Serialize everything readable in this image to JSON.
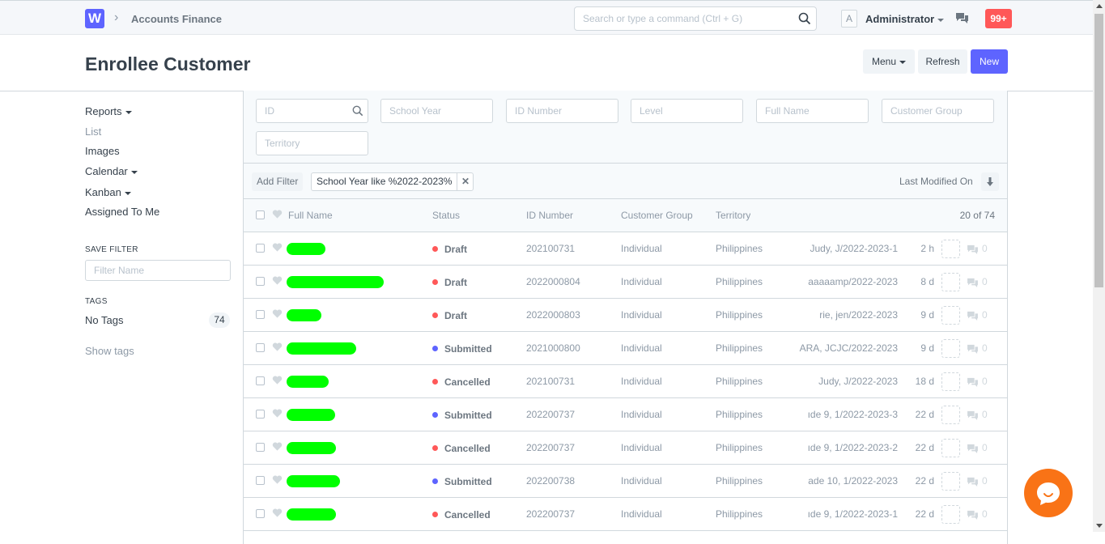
{
  "navbar": {
    "logo_letter": "W",
    "breadcrumb": "Accounts Finance",
    "search_placeholder": "Search or type a command (Ctrl + G)",
    "avatar_letter": "A",
    "user": "Administrator",
    "notifications": "99+"
  },
  "page": {
    "title": "Enrollee Customer",
    "menu_label": "Menu",
    "refresh_label": "Refresh",
    "new_label": "New"
  },
  "sidebar": {
    "items": [
      {
        "label": "Reports",
        "dropdown": true
      },
      {
        "label": "List",
        "dropdown": false
      },
      {
        "label": "Images",
        "dropdown": false
      },
      {
        "label": "Calendar",
        "dropdown": true
      },
      {
        "label": "Kanban",
        "dropdown": true
      },
      {
        "label": "Assigned To Me",
        "dropdown": false
      }
    ],
    "save_filter_label": "SAVE FILTER",
    "filter_name_placeholder": "Filter Name",
    "tags_label": "TAGS",
    "no_tags_label": "No Tags",
    "no_tags_count": "74",
    "show_tags_label": "Show tags"
  },
  "filters": {
    "fields": [
      "ID",
      "School Year",
      "ID Number",
      "Level",
      "Full Name",
      "Customer Group",
      "Territory"
    ],
    "add_filter_label": "Add Filter",
    "active_filter": "School Year like %2022-2023%",
    "sort_label": "Last Modified On"
  },
  "list": {
    "columns": {
      "full_name": "Full Name",
      "status": "Status",
      "id_number": "ID Number",
      "customer_group": "Customer Group",
      "territory": "Territory"
    },
    "count": "20 of 74",
    "rows": [
      {
        "status": "Draft",
        "status_color": "#ff5858",
        "id_number": "202100731",
        "customer_group": "Individual",
        "territory": "Philippines",
        "ref": "Judy, J/2022-2023-1",
        "modified": "2 h",
        "comments": "0"
      },
      {
        "status": "Draft",
        "status_color": "#ff5858",
        "id_number": "2022000804",
        "customer_group": "Individual",
        "territory": "Philippines",
        "ref": "aaaaamp/2022-2023",
        "modified": "8 d",
        "comments": "0"
      },
      {
        "status": "Draft",
        "status_color": "#ff5858",
        "id_number": "2022000803",
        "customer_group": "Individual",
        "territory": "Philippines",
        "ref": "rie, jen/2022-2023",
        "modified": "9 d",
        "comments": "0"
      },
      {
        "status": "Submitted",
        "status_color": "#5e64ff",
        "id_number": "2021000800",
        "customer_group": "Individual",
        "territory": "Philippines",
        "ref": "ARA, JCJC/2022-2023",
        "modified": "9 d",
        "comments": "0"
      },
      {
        "status": "Cancelled",
        "status_color": "#ff5858",
        "id_number": "202100731",
        "customer_group": "Individual",
        "territory": "Philippines",
        "ref": "Judy, J/2022-2023",
        "modified": "18 d",
        "comments": "0"
      },
      {
        "status": "Submitted",
        "status_color": "#5e64ff",
        "id_number": "202200737",
        "customer_group": "Individual",
        "territory": "Philippines",
        "ref": "ıde 9, 1/2022-2023-3",
        "modified": "22 d",
        "comments": "0"
      },
      {
        "status": "Cancelled",
        "status_color": "#ff5858",
        "id_number": "202200737",
        "customer_group": "Individual",
        "territory": "Philippines",
        "ref": "ıde 9, 1/2022-2023-2",
        "modified": "22 d",
        "comments": "0"
      },
      {
        "status": "Submitted",
        "status_color": "#5e64ff",
        "id_number": "202200738",
        "customer_group": "Individual",
        "territory": "Philippines",
        "ref": "ade 10, 1/2022-2023",
        "modified": "22 d",
        "comments": "0"
      },
      {
        "status": "Cancelled",
        "status_color": "#ff5858",
        "id_number": "202200737",
        "customer_group": "Individual",
        "territory": "Philippines",
        "ref": "ıde 9, 1/2022-2023-1",
        "modified": "22 d",
        "comments": "0"
      }
    ]
  }
}
